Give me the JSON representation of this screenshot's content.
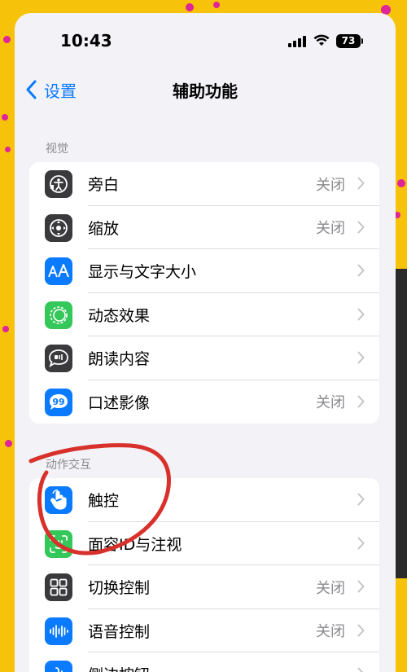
{
  "status_bar": {
    "time": "10:43",
    "battery": "73"
  },
  "nav": {
    "back_label": "设置",
    "title": "辅助功能"
  },
  "sections": [
    {
      "header": "视觉",
      "rows": [
        {
          "label": "旁白",
          "value": "关闭",
          "icon": "voiceover-icon",
          "color": "#3a3a3c"
        },
        {
          "label": "缩放",
          "value": "关闭",
          "icon": "zoom-icon",
          "color": "#3a3a3c"
        },
        {
          "label": "显示与文字大小",
          "value": "",
          "icon": "text-size-icon",
          "color": "#0a7aff"
        },
        {
          "label": "动态效果",
          "value": "",
          "icon": "motion-icon",
          "color": "#34c759"
        },
        {
          "label": "朗读内容",
          "value": "",
          "icon": "spoken-content-icon",
          "color": "#3a3a3c"
        },
        {
          "label": "口述影像",
          "value": "关闭",
          "icon": "audio-descriptions-icon",
          "color": "#0a7aff"
        }
      ]
    },
    {
      "header": "动作交互",
      "rows": [
        {
          "label": "触控",
          "value": "",
          "icon": "touch-icon",
          "color": "#0a7aff"
        },
        {
          "label": "面容ID与注视",
          "value": "",
          "icon": "face-id-icon",
          "color": "#34c759"
        },
        {
          "label": "切换控制",
          "value": "关闭",
          "icon": "switch-control-icon",
          "color": "#3a3a3c"
        },
        {
          "label": "语音控制",
          "value": "关闭",
          "icon": "voice-control-icon",
          "color": "#0a7aff"
        },
        {
          "label": "侧边按钮",
          "value": "",
          "icon": "side-button-icon",
          "color": "#0a7aff"
        }
      ]
    }
  ],
  "annotation_color": "#d8312c"
}
